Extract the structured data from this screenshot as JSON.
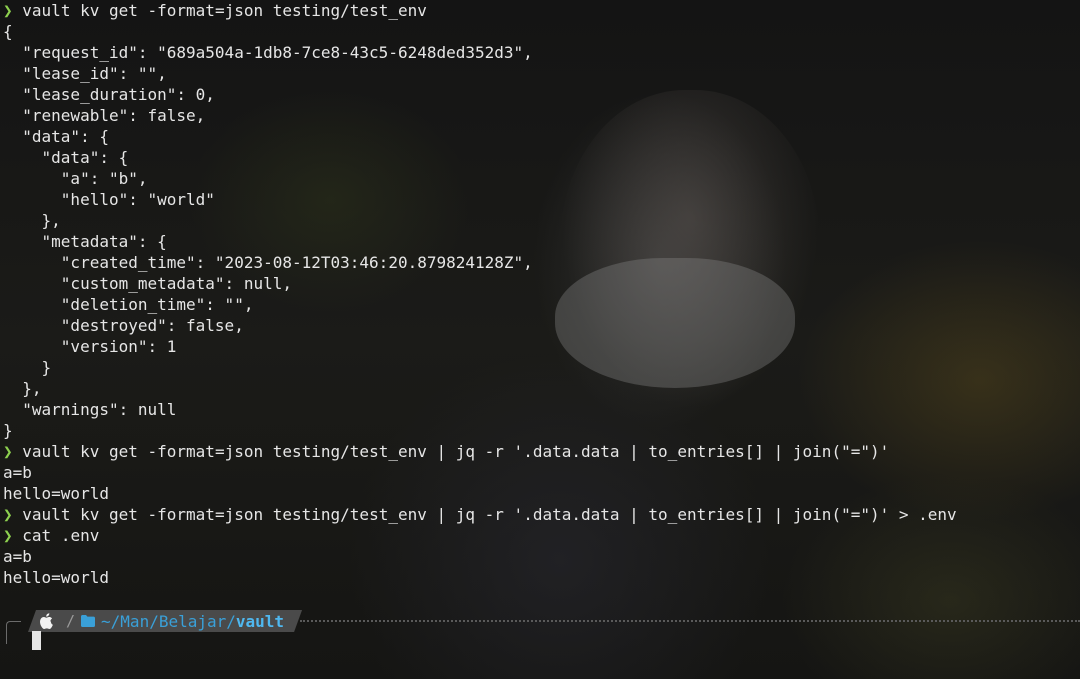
{
  "colors": {
    "prompt_arrow": "#8ed14f",
    "text": "#e6e6e6",
    "path_prefix": "#3aa0d8",
    "path_leaf": "#4fb8f0",
    "segment_bg": "#4a4a4a"
  },
  "terminal": {
    "prompt_symbol": "❯",
    "lines": [
      {
        "type": "prompt",
        "text": "vault kv get -format=json testing/test_env"
      },
      {
        "type": "output",
        "text": "{"
      },
      {
        "type": "output",
        "text": "  \"request_id\": \"689a504a-1db8-7ce8-43c5-6248ded352d3\","
      },
      {
        "type": "output",
        "text": "  \"lease_id\": \"\","
      },
      {
        "type": "output",
        "text": "  \"lease_duration\": 0,"
      },
      {
        "type": "output",
        "text": "  \"renewable\": false,"
      },
      {
        "type": "output",
        "text": "  \"data\": {"
      },
      {
        "type": "output",
        "text": "    \"data\": {"
      },
      {
        "type": "output",
        "text": "      \"a\": \"b\","
      },
      {
        "type": "output",
        "text": "      \"hello\": \"world\""
      },
      {
        "type": "output",
        "text": "    },"
      },
      {
        "type": "output",
        "text": "    \"metadata\": {"
      },
      {
        "type": "output",
        "text": "      \"created_time\": \"2023-08-12T03:46:20.879824128Z\","
      },
      {
        "type": "output",
        "text": "      \"custom_metadata\": null,"
      },
      {
        "type": "output",
        "text": "      \"deletion_time\": \"\","
      },
      {
        "type": "output",
        "text": "      \"destroyed\": false,"
      },
      {
        "type": "output",
        "text": "      \"version\": 1"
      },
      {
        "type": "output",
        "text": "    }"
      },
      {
        "type": "output",
        "text": "  },"
      },
      {
        "type": "output",
        "text": "  \"warnings\": null"
      },
      {
        "type": "output",
        "text": "}"
      },
      {
        "type": "prompt",
        "text": "vault kv get -format=json testing/test_env | jq -r '.data.data | to_entries[] | join(\"=\")'"
      },
      {
        "type": "output",
        "text": "a=b"
      },
      {
        "type": "output",
        "text": "hello=world"
      },
      {
        "type": "prompt",
        "text": "vault kv get -format=json testing/test_env | jq -r '.data.data | to_entries[] | join(\"=\")' > .env"
      },
      {
        "type": "prompt",
        "text": "cat .env"
      },
      {
        "type": "output",
        "text": "a=b"
      },
      {
        "type": "output",
        "text": "hello=world"
      }
    ]
  },
  "status_prompt": {
    "os_icon": "apple-icon",
    "separator": "/",
    "folder_icon": "folder-icon",
    "path_prefix": "~/Man/Belajar/",
    "path_leaf": "vault"
  }
}
